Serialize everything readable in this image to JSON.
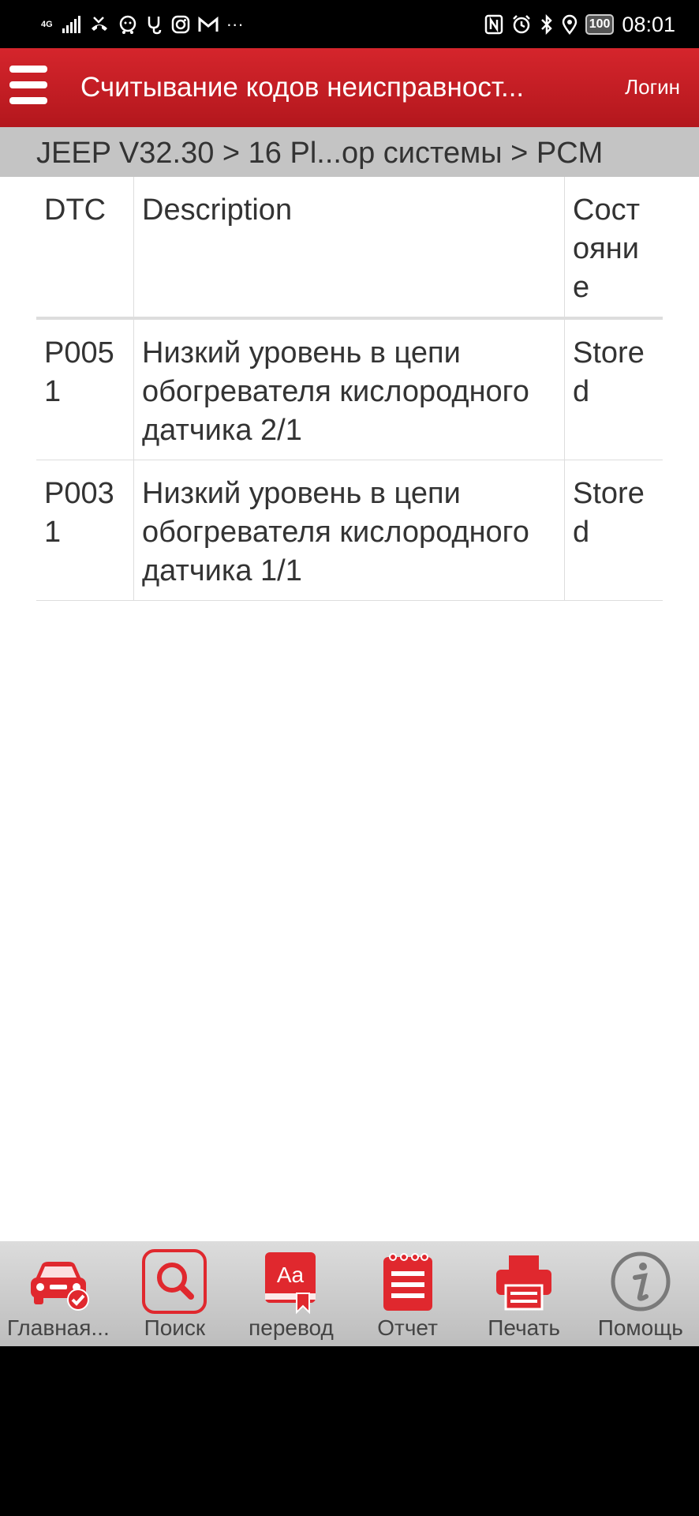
{
  "status_bar": {
    "network": "4G",
    "time": "08:01",
    "battery": "100",
    "more": "···"
  },
  "header": {
    "title": "Считывание кодов неисправност...",
    "login_label": "Логин"
  },
  "breadcrumb": "JEEP V32.30 > 16 Pl...ор системы > PCM",
  "table": {
    "columns": [
      "DTC",
      "Description",
      "Состояние"
    ],
    "rows": [
      {
        "dtc": "P0051",
        "description": "Низкий уровень в цепи обогревателя кислородного датчика 2/1",
        "status": "Stored"
      },
      {
        "dtc": "P0031",
        "description": "Низкий уровень в цепи обогревателя кислородного датчика 1/1",
        "status": "Stored"
      }
    ]
  },
  "toolbar": {
    "items": [
      {
        "label": "Главная...",
        "icon": "car-check-icon"
      },
      {
        "label": "Поиск",
        "icon": "search-icon"
      },
      {
        "label": "перевод",
        "icon": "translate-icon"
      },
      {
        "label": "Отчет",
        "icon": "report-icon"
      },
      {
        "label": "Печать",
        "icon": "print-icon"
      },
      {
        "label": "Помощь",
        "icon": "info-icon"
      }
    ]
  },
  "colors": {
    "header_red": "#c8191f",
    "icon_red": "#e0282e",
    "breadcrumb_bg": "#c4c4c4",
    "toolbar_bg": "#cfcfcf"
  }
}
